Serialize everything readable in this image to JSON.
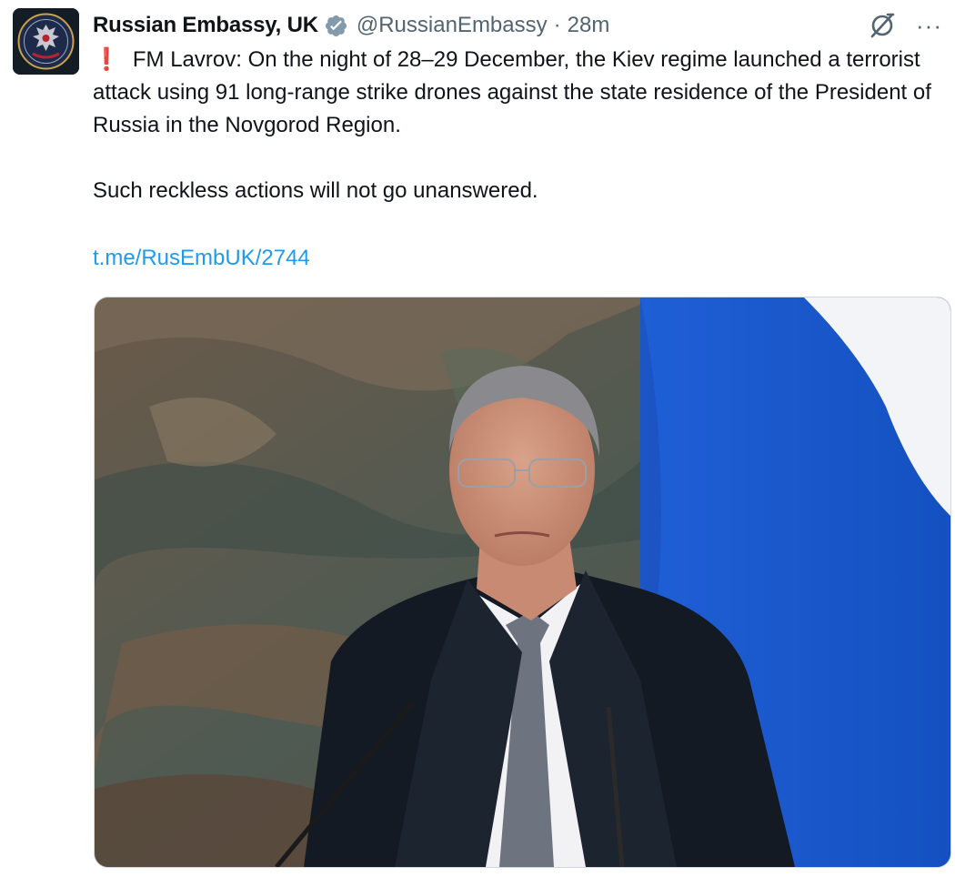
{
  "tweet": {
    "display_name": "Russian Embassy, UK",
    "handle": "@RussianEmbassy",
    "separator": "·",
    "timestamp": "28m",
    "body_line_1": "FM Lavrov: On the night of 28–29 December, the Kiev regime launched a terrorist attack using 91 long-range strike drones against the state residence of the President of Russia in the Novgorod Region.",
    "body_line_2": "Such reckless actions will not go unanswered.",
    "link": "t.me/RusEmbUK/2744",
    "more_label": "···"
  },
  "icons": {
    "exclamation": "❗",
    "verified": "verified-badge-icon",
    "grok": "grok-icon",
    "more": "more-options-icon"
  },
  "colors": {
    "text": "#0f1419",
    "secondary": "#536471",
    "link": "#1d9bf0",
    "verified_badge": "#829aab",
    "alert": "#e0142e"
  }
}
